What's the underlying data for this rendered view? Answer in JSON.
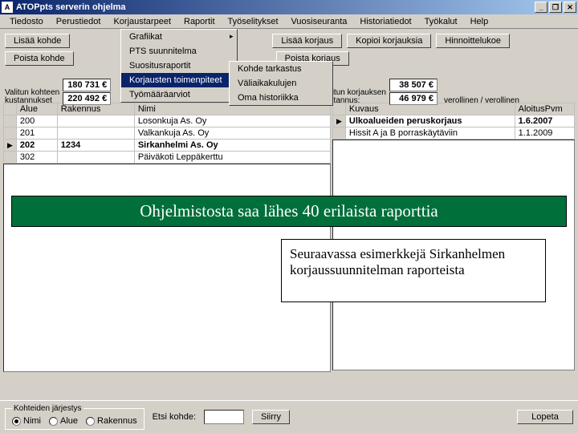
{
  "titlebar": {
    "icon": "A",
    "title": "ATOPpts  serverin ohjelma"
  },
  "winbtns": {
    "min": "_",
    "max": "❐",
    "close": "✕"
  },
  "menubar": {
    "items": [
      "Tiedosto",
      "Perustiedot",
      "Korjaustarpeet",
      "Raportit",
      "Työselitykset",
      "Vuosiseuranta",
      "Historiatiedot",
      "Työkalut",
      "Help"
    ]
  },
  "toolbar_row1": {
    "btn1": "Lisää kohde",
    "btn2": "Lisää korjaus",
    "btn3": "Kopioi korjauksia",
    "btn4": "Hinnoittelukoe"
  },
  "toolbar_row2": {
    "btn1": "Poista kohde",
    "btn2": "Poista korjaus"
  },
  "menu1": {
    "items": [
      "Grafiikat",
      "PTS suunnitelma",
      "Suositusraportit",
      "Korjausten toimenpiteet",
      "Työmääräarviot"
    ]
  },
  "menu2": {
    "items": [
      "Kohde tarkastus",
      "Väliaikakulujen",
      "Oma historiikka"
    ]
  },
  "left_info": {
    "line1_label": "Valitun kohteen",
    "line2_label": "kustannukset",
    "val1": "180 731 €",
    "val2": "220 492 €"
  },
  "right_info": {
    "line1_label": "Valitun korjauksen",
    "line2_label": "kustannus:",
    "val1": "38 507 €",
    "val2": "46 979 €",
    "suffix": "verollinen / verollinen"
  },
  "left_table": {
    "headers": [
      "Alue",
      "Rakennus",
      "Nimi"
    ],
    "rows": [
      [
        "200",
        "",
        "Losonkuja As. Oy"
      ],
      [
        "201",
        "",
        "Valkankuja As. Oy"
      ],
      [
        "202",
        "1234",
        "Sirkanhelmi As. Oy"
      ],
      [
        "302",
        "",
        "Päiväkoti Leppäkerttu"
      ]
    ],
    "selected_row": 2
  },
  "right_table": {
    "headers": [
      "Kuvaus",
      "AloitusPvm"
    ],
    "rows": [
      [
        "Ulkoalueiden peruskorjaus",
        "1.6.2007"
      ],
      [
        "Hissit A ja B porraskäytäviin",
        "1.1.2009"
      ]
    ],
    "selected_row": 0
  },
  "banner": "Ohjelmistosta saa lähes 40 erilaista raporttia",
  "whitebox": "Seuraavassa esimerkkejä Sirkanhelmen korjaussuunnitelman raporteista",
  "bottom": {
    "group_label": "Kohteiden järjestys",
    "radios": [
      "Nimi",
      "Alue",
      "Rakennus"
    ],
    "selected": 0,
    "search_label": "Etsi kohde:",
    "search_btn": "Siirry",
    "quit": "Lopeta"
  }
}
